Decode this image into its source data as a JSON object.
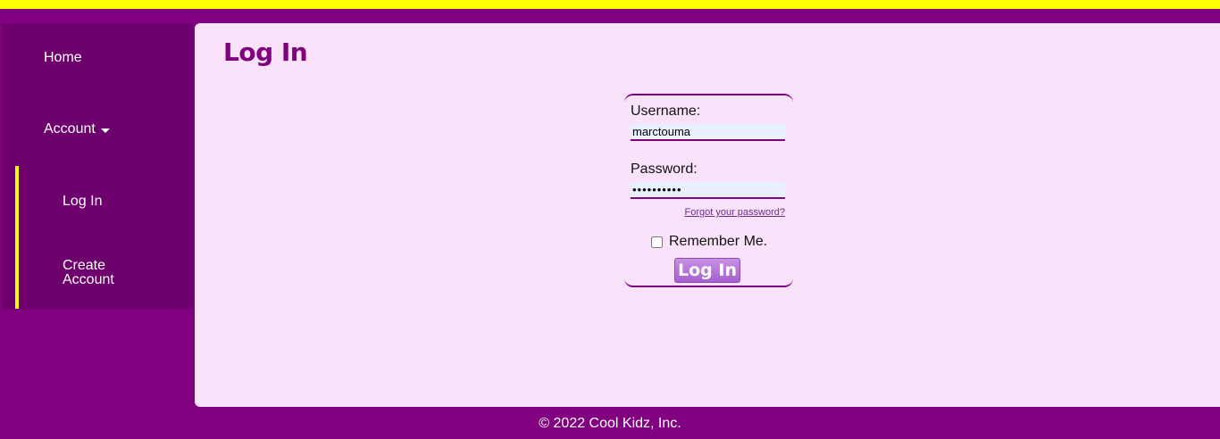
{
  "colors": {
    "page_background": "#800080",
    "top_bar": "#ffff00",
    "sidebar": "#6e006e",
    "content_background": "#fae3fa",
    "accent": "#800080",
    "active_indicator": "#ffff00"
  },
  "nav": {
    "home": "Home",
    "account": "Account",
    "account_icon": "caret-down-icon",
    "submenu": {
      "login": "Log In",
      "create_account": "Create Account"
    }
  },
  "page": {
    "title": "Log In"
  },
  "form": {
    "username_label": "Username:",
    "username_value": "marctouma",
    "password_label": "Password:",
    "password_value": "••••••••••",
    "forgot_link": "Forgot your password?",
    "remember_label": "Remember Me.",
    "remember_checked": false,
    "submit_label": "Log In"
  },
  "footer": {
    "text": "© 2022 Cool Kidz, Inc."
  }
}
